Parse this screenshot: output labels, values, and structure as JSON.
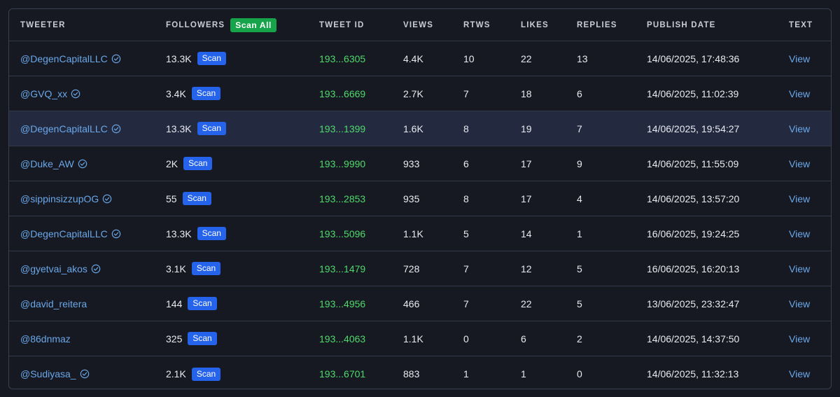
{
  "headers": {
    "tweeter": "TWEETER",
    "followers": "FOLLOWERS",
    "scan_all": "Scan All",
    "tweet_id": "TWEET ID",
    "views": "VIEWS",
    "rtws": "RTWS",
    "likes": "LIKES",
    "replies": "REPLIES",
    "publish_date": "PUBLISH DATE",
    "text": "TEXT"
  },
  "colors": {
    "link": "#6aa7e8",
    "tweet_id": "#4fd96b",
    "scan_button": "#2563eb",
    "scan_all_button": "#16a34a",
    "highlight_row": "#232a40"
  },
  "icons": {
    "verified": "verified-check-icon"
  },
  "rows": [
    {
      "handle": "@DegenCapitalLLC",
      "verified": true,
      "followers": "13.3K",
      "scan": "Scan",
      "tweet_id": "193...6305",
      "views": "4.4K",
      "rtws": "10",
      "likes": "22",
      "replies": "13",
      "date": "14/06/2025, 17:48:36",
      "text": "View"
    },
    {
      "handle": "@GVQ_xx",
      "verified": true,
      "followers": "3.4K",
      "scan": "Scan",
      "tweet_id": "193...6669",
      "views": "2.7K",
      "rtws": "7",
      "likes": "18",
      "replies": "6",
      "date": "14/06/2025, 11:02:39",
      "text": "View"
    },
    {
      "handle": "@DegenCapitalLLC",
      "verified": true,
      "followers": "13.3K",
      "scan": "Scan",
      "tweet_id": "193...1399",
      "views": "1.6K",
      "rtws": "8",
      "likes": "19",
      "replies": "7",
      "date": "14/06/2025, 19:54:27",
      "text": "View",
      "highlighted": true
    },
    {
      "handle": "@Duke_AW",
      "verified": true,
      "followers": "2K",
      "scan": "Scan",
      "tweet_id": "193...9990",
      "views": "933",
      "rtws": "6",
      "likes": "17",
      "replies": "9",
      "date": "14/06/2025, 11:55:09",
      "text": "View"
    },
    {
      "handle": "@sippinsizzupOG",
      "verified": true,
      "followers": "55",
      "scan": "Scan",
      "tweet_id": "193...2853",
      "views": "935",
      "rtws": "8",
      "likes": "17",
      "replies": "4",
      "date": "14/06/2025, 13:57:20",
      "text": "View"
    },
    {
      "handle": "@DegenCapitalLLC",
      "verified": true,
      "followers": "13.3K",
      "scan": "Scan",
      "tweet_id": "193...5096",
      "views": "1.1K",
      "rtws": "5",
      "likes": "14",
      "replies": "1",
      "date": "16/06/2025, 19:24:25",
      "text": "View"
    },
    {
      "handle": "@gyetvai_akos",
      "verified": true,
      "followers": "3.1K",
      "scan": "Scan",
      "tweet_id": "193...1479",
      "views": "728",
      "rtws": "7",
      "likes": "12",
      "replies": "5",
      "date": "16/06/2025, 16:20:13",
      "text": "View"
    },
    {
      "handle": "@david_reitera",
      "verified": false,
      "followers": "144",
      "scan": "Scan",
      "tweet_id": "193...4956",
      "views": "466",
      "rtws": "7",
      "likes": "22",
      "replies": "5",
      "date": "13/06/2025, 23:32:47",
      "text": "View"
    },
    {
      "handle": "@86dnmaz",
      "verified": false,
      "followers": "325",
      "scan": "Scan",
      "tweet_id": "193...4063",
      "views": "1.1K",
      "rtws": "0",
      "likes": "6",
      "replies": "2",
      "date": "14/06/2025, 14:37:50",
      "text": "View"
    },
    {
      "handle": "@Sudiyasa_",
      "verified": true,
      "followers": "2.1K",
      "scan": "Scan",
      "tweet_id": "193...6701",
      "views": "883",
      "rtws": "1",
      "likes": "1",
      "replies": "0",
      "date": "14/06/2025, 11:32:13",
      "text": "View"
    }
  ]
}
